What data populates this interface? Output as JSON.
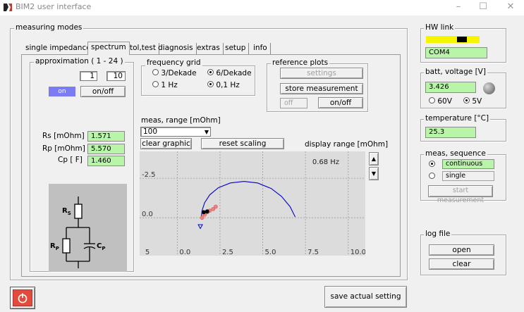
{
  "window": {
    "title": "BIM2 user interface"
  },
  "measuring_modes": {
    "group_label": "measuring modes",
    "tabs": [
      "single impedance",
      "spectrum",
      "tol,test",
      "diagnosis",
      "extras",
      "setup",
      "info"
    ],
    "active_tab": "spectrum"
  },
  "approximation": {
    "label": "approximation ( 1 - 24 )",
    "from": "1",
    "to": "10",
    "on_label": "on",
    "onoff_label": "on/off",
    "values": [
      {
        "name": "Rs [mOhm]",
        "value": "1.571"
      },
      {
        "name": "Rp [mOhm]",
        "value": "5.570"
      },
      {
        "name": "Cp  [ F]",
        "value": "1.460"
      }
    ],
    "circuit_labels": {
      "rs": "R",
      "rs_sub": "S",
      "rp": "R",
      "rp_sub": "P",
      "cp": "C",
      "cp_sub": "P"
    }
  },
  "frequency_grid": {
    "label": "frequency grid",
    "options": [
      {
        "label": "3/Dekade",
        "selected": false
      },
      {
        "label": "6/Dekade",
        "selected": true
      },
      {
        "label": "1 Hz",
        "selected": false
      },
      {
        "label": "0,1 Hz",
        "selected": true
      }
    ]
  },
  "reference_plots": {
    "label": "reference plots",
    "settings_label": "settings",
    "store_label": "store measurement",
    "state": "off",
    "onoff_label": "on/off"
  },
  "meas_range": {
    "label": "meas, range [mOhm]",
    "selected": "100",
    "clear_label": "clear graphic",
    "reset_label": "reset scaling",
    "display_range_label": "display range [mOhm]"
  },
  "chart_data": {
    "type": "scatter",
    "annotation": "0.68 Hz",
    "x_ticks": [
      "5",
      "0.0",
      "2.5",
      "5.0",
      "7.5",
      "10.0"
    ],
    "y_ticks": [
      "-2.5",
      "0.0"
    ],
    "xlim": [
      -2.2,
      11
    ],
    "ylim": [
      -4.2,
      2.4
    ],
    "series": [
      {
        "type": "line",
        "color": "#0000cc",
        "x": [
          1.4,
          1.45,
          1.6,
          1.9,
          2.4,
          3.1,
          3.9,
          4.7,
          5.5,
          6.1,
          6.6,
          6.9
        ],
        "y": [
          0.0,
          -0.45,
          -0.95,
          -1.45,
          -1.9,
          -2.2,
          -2.3,
          -2.2,
          -1.85,
          -1.35,
          -0.7,
          -0.05
        ]
      },
      {
        "type": "points",
        "color": "#f08080",
        "x": [
          1.45,
          1.6,
          1.75,
          1.9,
          2.1,
          2.25
        ],
        "y": [
          0.0,
          -0.2,
          -0.35,
          -0.45,
          -0.55,
          -0.7
        ]
      },
      {
        "type": "points",
        "color": "#000000",
        "x": [
          1.55,
          1.75
        ],
        "y": [
          -0.35,
          -0.4
        ]
      },
      {
        "type": "triangle",
        "color": "#0000cc",
        "x": [
          1.35
        ],
        "y": [
          0.55
        ]
      }
    ]
  },
  "hw_link": {
    "label": "HW link",
    "port": "COM4"
  },
  "battery": {
    "label": "batt, voltage [V]",
    "value": "3.426",
    "options": [
      {
        "label": "60V",
        "selected": false
      },
      {
        "label": "5V",
        "selected": true
      }
    ]
  },
  "temperature": {
    "label": "temperature [°C]",
    "value": "25.3"
  },
  "meas_sequence": {
    "label": "meas, sequence",
    "options": [
      {
        "label": "continuous",
        "selected": true
      },
      {
        "label": "single",
        "selected": false
      }
    ],
    "start_label": "start measurement"
  },
  "log_file": {
    "label": "log file",
    "open_label": "open",
    "clear_label": "clear"
  },
  "footer": {
    "save_label": "save actual setting"
  }
}
